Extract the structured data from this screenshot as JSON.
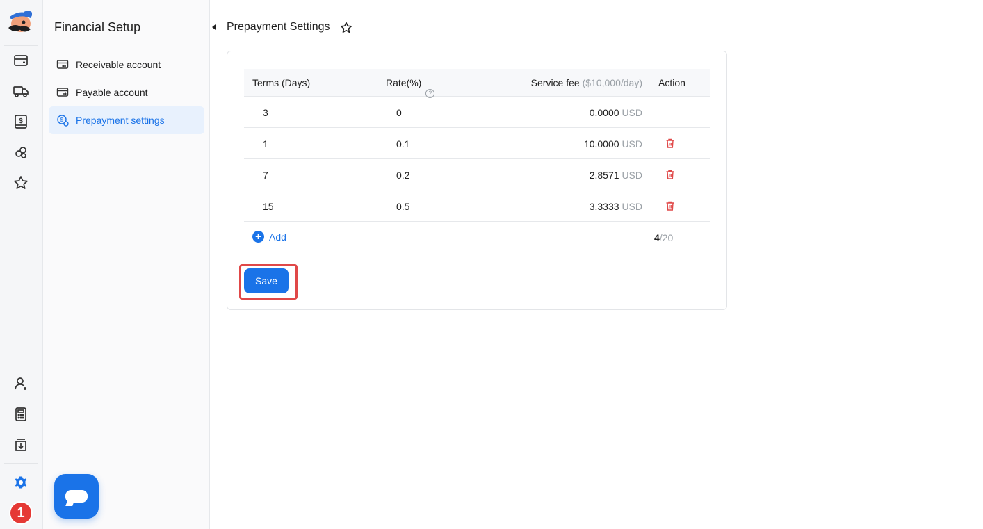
{
  "sidebar": {
    "title": "Financial Setup",
    "items": [
      {
        "label": "Receivable account",
        "icon": "receivable-icon",
        "active": false
      },
      {
        "label": "Payable account",
        "icon": "payable-icon",
        "active": false
      },
      {
        "label": "Prepayment settings",
        "icon": "prepayment-icon",
        "active": true
      }
    ]
  },
  "rail": {
    "top_icons": [
      "wallet-icon",
      "truck-icon",
      "dollar-doc-icon",
      "users-icon",
      "star-icon"
    ],
    "bottom_icons": [
      "user-add-icon",
      "calculator-icon",
      "download-doc-icon",
      "gear-icon"
    ],
    "notification_count": "1"
  },
  "page": {
    "title": "Prepayment Settings"
  },
  "table": {
    "headers": {
      "terms": "Terms (Days)",
      "rate": "Rate(%)",
      "fee": "Service fee",
      "fee_unit": "($10,000/day)",
      "action": "Action"
    },
    "rows": [
      {
        "terms": "3",
        "rate": "0",
        "fee": "0.0000",
        "currency": "USD",
        "deletable": false
      },
      {
        "terms": "1",
        "rate": "0.1",
        "fee": "10.0000",
        "currency": "USD",
        "deletable": true
      },
      {
        "terms": "7",
        "rate": "0.2",
        "fee": "2.8571",
        "currency": "USD",
        "deletable": true
      },
      {
        "terms": "15",
        "rate": "0.5",
        "fee": "3.3333",
        "currency": "USD",
        "deletable": true
      }
    ],
    "add_label": "Add",
    "count_current": "4",
    "count_max": "/20"
  },
  "actions": {
    "save_label": "Save"
  },
  "colors": {
    "accent": "#1a73e8",
    "danger": "#e04848",
    "active_bg": "#e8f1fd"
  }
}
